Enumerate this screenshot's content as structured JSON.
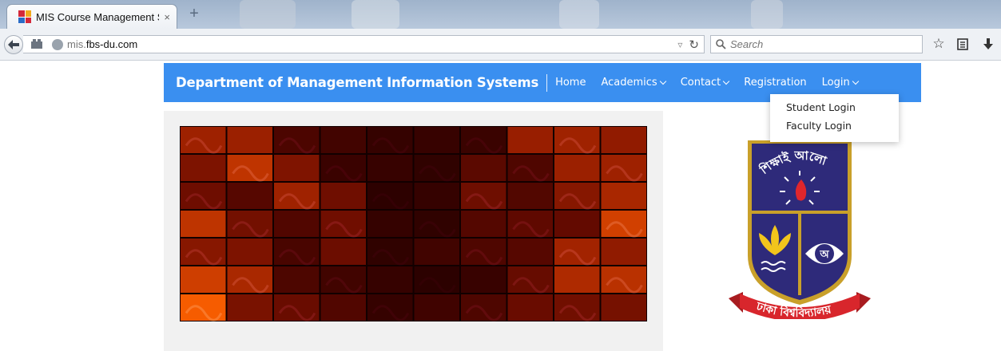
{
  "browser": {
    "tab": {
      "title": "MIS Course Management S...",
      "close_glyph": "×"
    },
    "new_tab_glyph": "+",
    "url": {
      "host_prefix": "mis.",
      "host_domain": "fbs-du.com"
    },
    "search": {
      "placeholder": "Search"
    },
    "icons": [
      "back-arrow-icon",
      "globe-icon",
      "reload-icon",
      "search-icon",
      "bookmark-star-icon",
      "reading-list-icon",
      "download-icon"
    ]
  },
  "site": {
    "brand": "Department of Management Information Systems",
    "menu": [
      {
        "label": "Home",
        "has_caret": false
      },
      {
        "label": "Academics",
        "has_caret": true
      },
      {
        "label": "Contact",
        "has_caret": true
      },
      {
        "label": "Registration",
        "has_caret": false
      },
      {
        "label": "Login",
        "has_caret": true
      }
    ],
    "login_dropdown": [
      "Student Login",
      "Faculty Login"
    ],
    "seal": {
      "top_text": "শিক্ষাই আলো",
      "ribbon_text": "ঢাকা বিশ্ববিদ্যালয়",
      "eye_letter": "অ"
    }
  },
  "colors": {
    "header_blue": "#3a8ff0",
    "seal_navy": "#2e2a7a",
    "seal_gold": "#c9a02a",
    "ribbon_red": "#d8262c"
  }
}
